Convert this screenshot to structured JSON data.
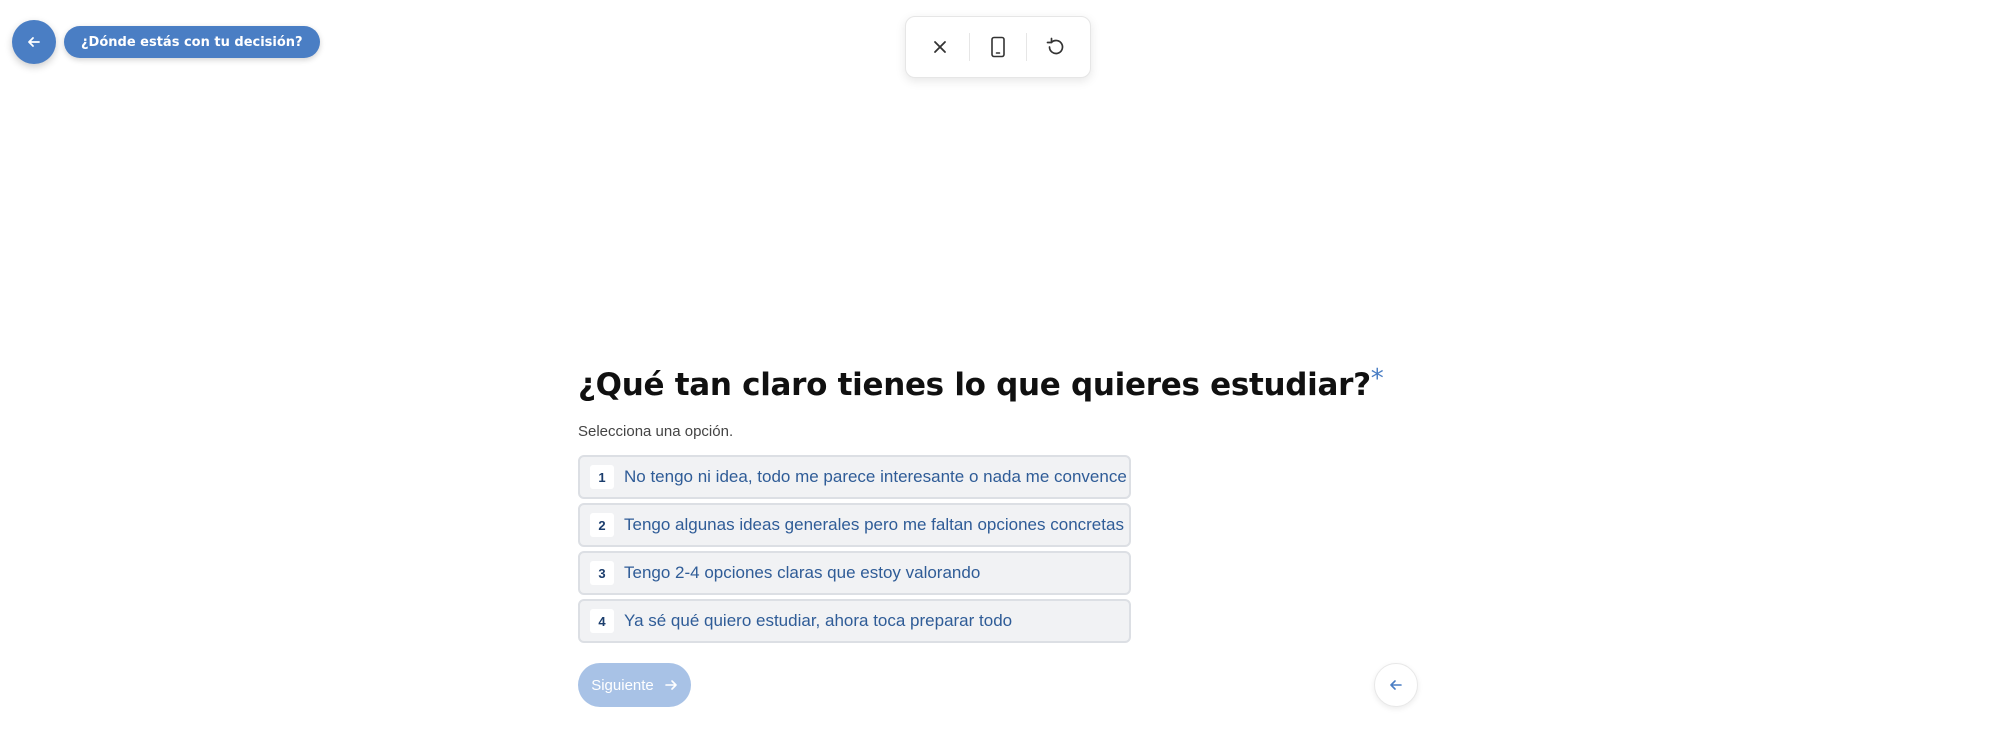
{
  "header": {
    "back_icon": "arrow-left-icon",
    "section_label": "¿Dónde estás con tu decisión?"
  },
  "toolbar": {
    "icons": [
      "close-icon",
      "mobile-phone-icon",
      "restart-icon"
    ]
  },
  "question": {
    "title": "¿Qué tan claro tienes lo que quieres estudiar?",
    "required_mark": "*",
    "hint": "Selecciona una opción."
  },
  "options": [
    {
      "key": "1",
      "label": "No tengo ni idea, todo me parece interesante o nada me convence"
    },
    {
      "key": "2",
      "label": "Tengo algunas ideas generales pero me faltan opciones concretas"
    },
    {
      "key": "3",
      "label": "Tengo 2-4 opciones claras que estoy valorando"
    },
    {
      "key": "4",
      "label": "Ya sé qué quiero estudiar, ahora toca preparar todo"
    }
  ],
  "footer": {
    "next_label": "Siguiente",
    "next_icon": "arrow-right-icon",
    "prev_icon": "arrow-left-icon"
  },
  "colors": {
    "accent": "#4a7ec4",
    "next_disabled": "#a8c2e6",
    "option_bg": "#f1f2f4",
    "option_text": "#2f5c97"
  }
}
